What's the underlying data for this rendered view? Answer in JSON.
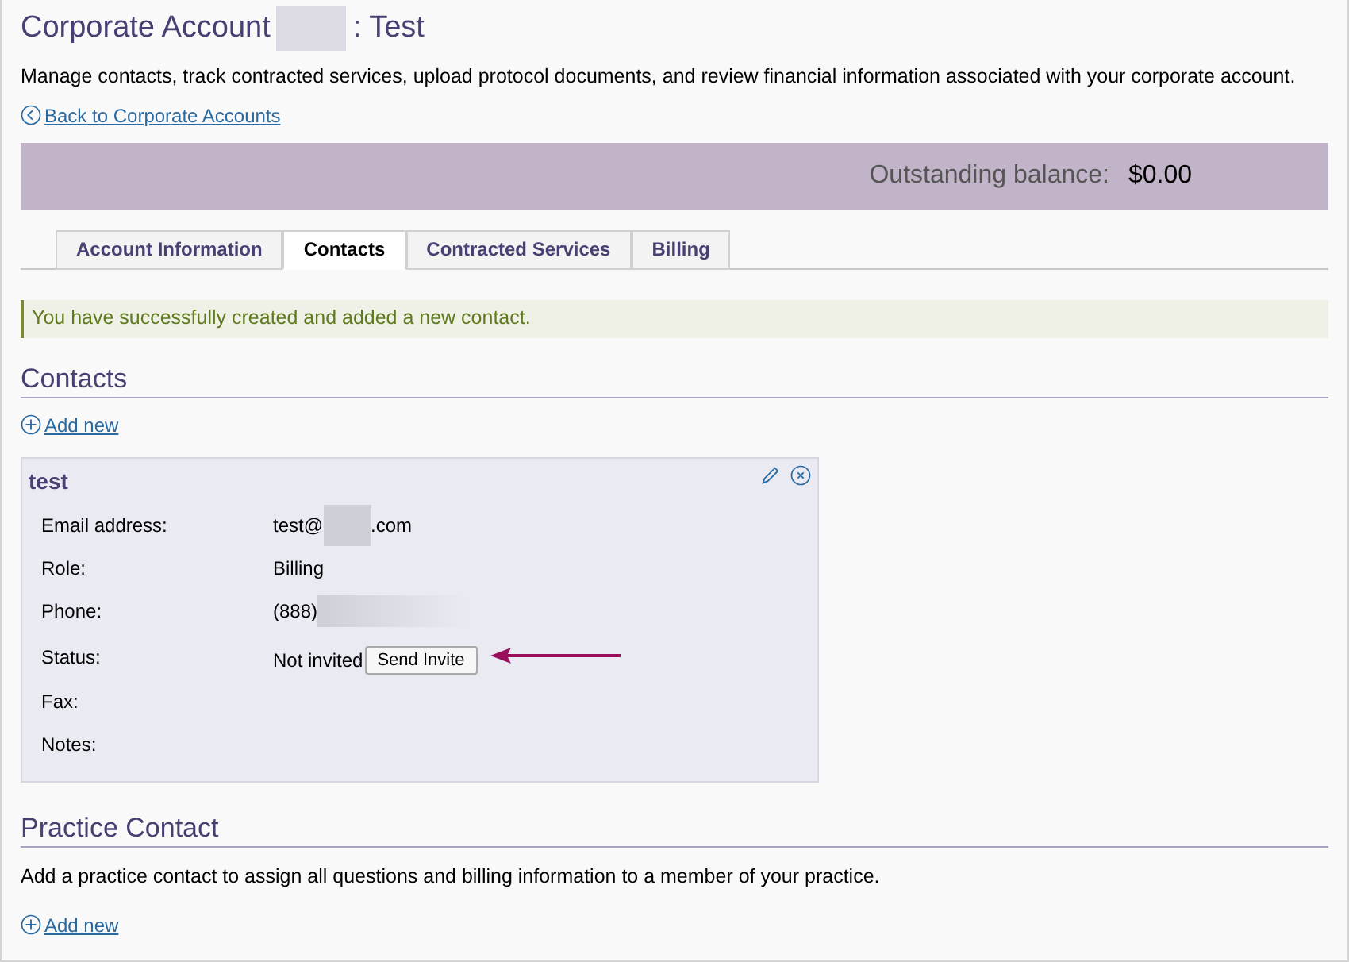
{
  "page": {
    "title": "Corporate Account",
    "title_suffix": ": Test",
    "description": "Manage contacts, track contracted services, upload protocol documents, and review financial information associated with your corporate account.",
    "back_link": "Back to Corporate Accounts"
  },
  "balance": {
    "label": "Outstanding balance:",
    "value": "$0.00"
  },
  "tabs": [
    {
      "label": "Account Information",
      "selected": false
    },
    {
      "label": "Contacts",
      "selected": true
    },
    {
      "label": "Contracted Services",
      "selected": false
    },
    {
      "label": "Billing",
      "selected": false
    }
  ],
  "alert": {
    "message": "You have successfully created and added a new contact."
  },
  "contacts": {
    "heading": "Contacts",
    "add_link": "Add new",
    "cards": [
      {
        "name": "test",
        "fields": [
          {
            "kind": "email",
            "label": "Email address:",
            "value": "test@",
            "value_suffix": ".com"
          },
          {
            "kind": "text",
            "label": "Role:",
            "value": "Billing"
          },
          {
            "kind": "phone",
            "label": "Phone:",
            "value": "(888)"
          },
          {
            "kind": "status",
            "label": "Status:",
            "value": "Not invited",
            "button": "Send Invite"
          },
          {
            "kind": "text",
            "label": "Fax:"
          },
          {
            "kind": "text",
            "label": "Notes:"
          }
        ]
      }
    ]
  },
  "practice_contact": {
    "heading": "Practice Contact",
    "description": "Add a practice contact to assign all questions and billing information to a member of your practice.",
    "add_link": "Add new"
  }
}
